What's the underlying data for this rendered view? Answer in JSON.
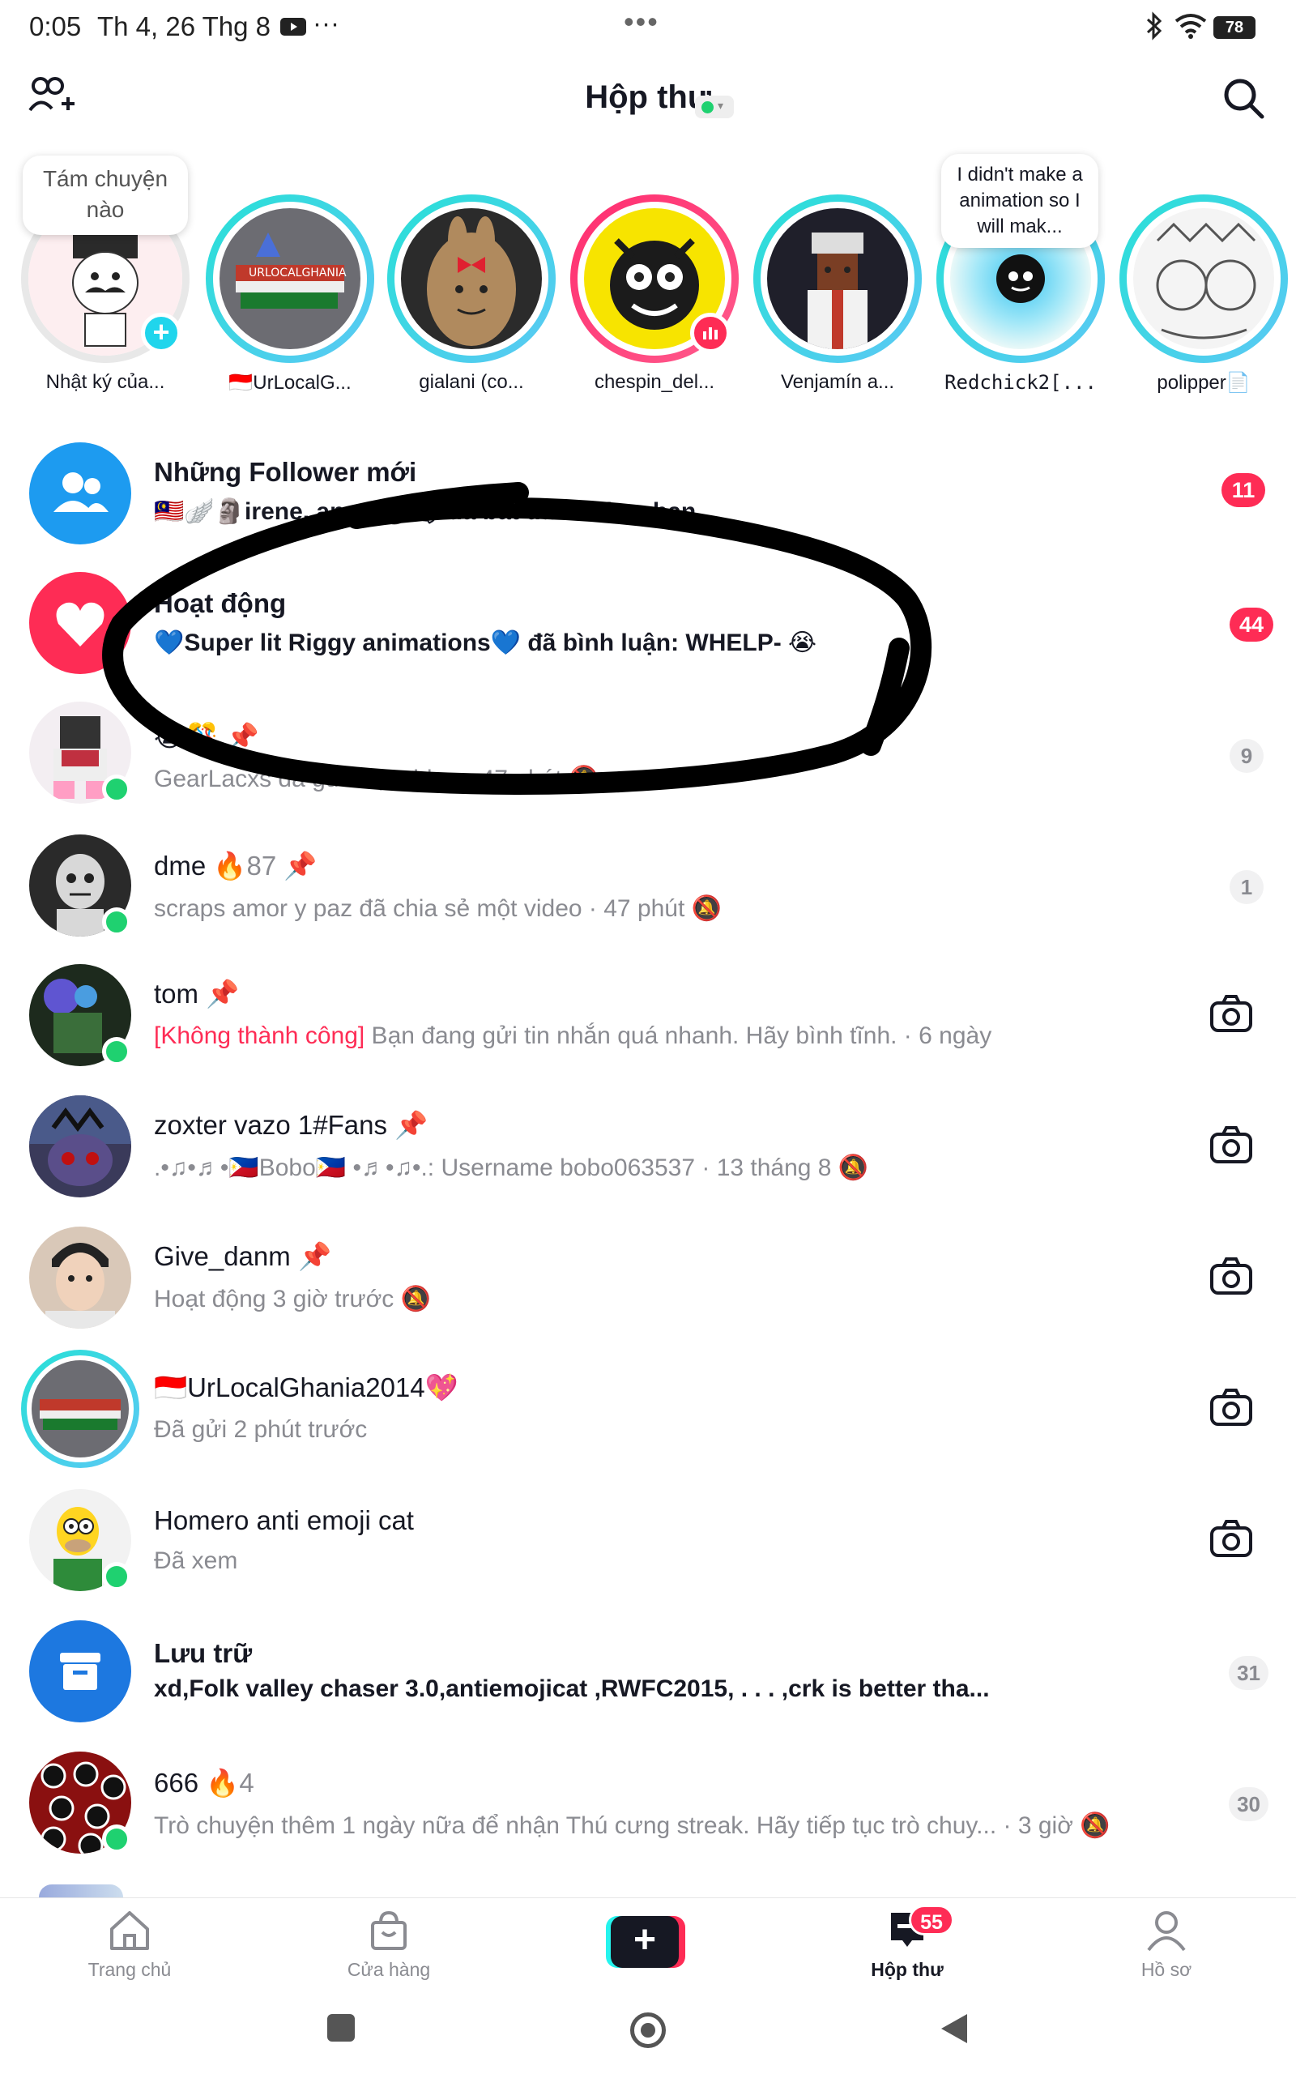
{
  "status_bar": {
    "time": "0:05",
    "date": "Th 4, 26 Thg 8",
    "more": "···",
    "center_dots": "•••",
    "battery": "78"
  },
  "header": {
    "title": "Hộp thư"
  },
  "stories": [
    {
      "label": "Nhật ký của...",
      "bubble": "Tám chuyện nào"
    },
    {
      "label": "🇮🇩UrLocalG..."
    },
    {
      "label": "gialani (co..."
    },
    {
      "label": "chespin_del..."
    },
    {
      "label": "Venjamín a..."
    },
    {
      "label": "Redchick2[...",
      "bubble": "I didn't make a animation so I will mak..."
    },
    {
      "label": "polipper📄"
    }
  ],
  "rows": [
    {
      "name": "Những Follower mới",
      "sub": "🇲🇾🪽🗿irene. angel🎱🕊 đã bắt đầu follow bạn.",
      "badge": "11"
    },
    {
      "name": "Hoạt động",
      "sub": "💙Super lit Riggy animations💙 đã bình luận: WHELP- 😭",
      "badge": "44"
    },
    {
      "name": "😭🎊 📌",
      "sub": "GearLacxs đã gửi một video · 47 phút 🔕",
      "badge": "9"
    },
    {
      "name": "dme",
      "streak": "87",
      "sub": "scraps amor y paz đã chia sẻ một video · 47 phút 🔕",
      "badge": "1"
    },
    {
      "name": "tom",
      "sub_error": "[Không thành công]",
      "sub": " Bạn đang gửi tin nhắn quá nhanh. Hãy bình tĩnh. · 6 ngày"
    },
    {
      "name": "zoxter vazo 1#Fans",
      "sub": ".•♫•♬•🇵🇭Bobo🇵🇭 •♬•♫•.: Username bobo063537 · 13 tháng 8 🔕"
    },
    {
      "name": "Give_danm",
      "sub": "Hoạt động 3 giờ trước 🔕"
    },
    {
      "name": "🇮🇩UrLocalGhania2014💖",
      "sub": "Đã gửi 2 phút trước"
    },
    {
      "name": "Homero anti emoji cat",
      "sub": "Đã xem"
    },
    {
      "name": "Lưu trữ",
      "sub": "xd,Folk valley chaser 3.0,antiemojicat ,RWFC2015,  .        .          .   ,crk is better tha...",
      "badge": "31"
    },
    {
      "name": "666",
      "streak": "4",
      "sub": "Trò chuyện thêm 1 ngày nữa để nhận Thú cưng streak. Hãy tiếp tục trò chuy...  · 3 giờ 🔕",
      "badge": "30"
    }
  ],
  "nav": {
    "home": "Trang chủ",
    "shop": "Cửa hàng",
    "inbox": "Hộp thư",
    "inbox_badge": "55",
    "profile": "Hồ sơ"
  },
  "colors": {
    "accent": "#fe2c55",
    "online": "#1fd170",
    "teal_ring": "#27e0d6",
    "blue_icon": "#1d9bf0"
  }
}
